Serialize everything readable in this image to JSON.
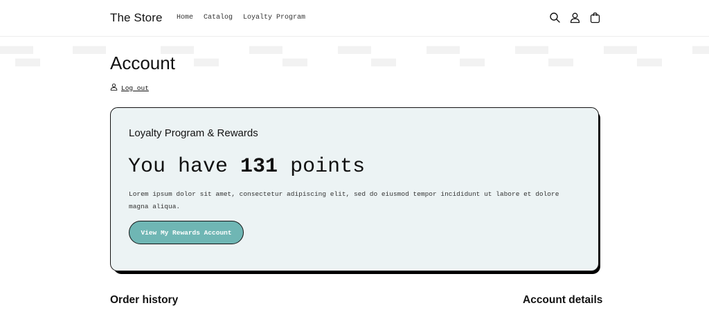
{
  "header": {
    "logo": "The Store",
    "nav": [
      "Home",
      "Catalog",
      "Loyalty Program"
    ],
    "icons": [
      "search-icon",
      "account-icon",
      "cart-icon"
    ]
  },
  "page": {
    "title": "Account",
    "logout_label": "Log out"
  },
  "loyalty": {
    "heading": "Loyalty Program & Rewards",
    "points_prefix": "You have",
    "points_value": "131",
    "points_suffix": "points",
    "description": "Lorem ipsum dolor sit amet, consectetur adipiscing elit, sed do eiusmod tempor incididunt ut labore et dolore magna aliqua.",
    "button_label": "View My Rewards Account"
  },
  "sections": {
    "order_history": "Order history",
    "account_details": "Account details"
  },
  "colors": {
    "card_background": "#ecf3f4",
    "button_teal": "#6fb6b4",
    "text": "#121212"
  }
}
